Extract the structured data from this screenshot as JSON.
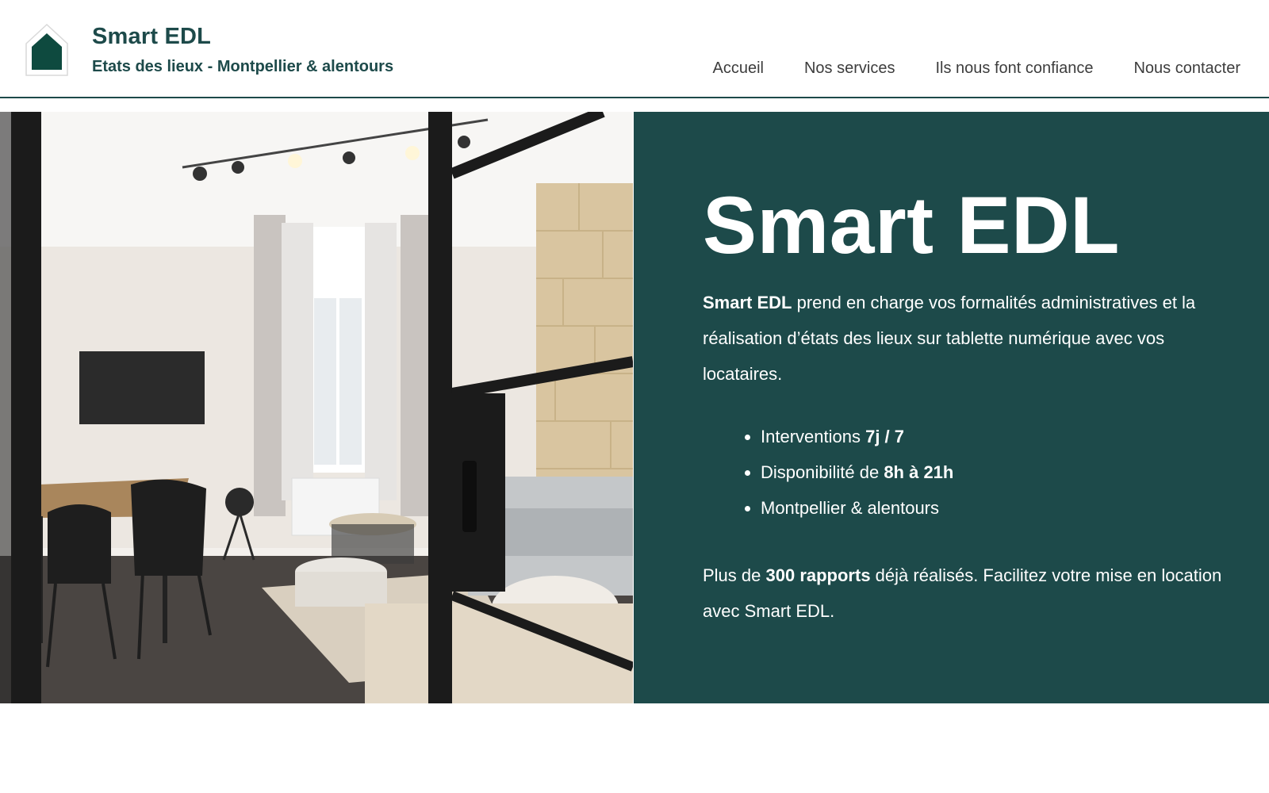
{
  "header": {
    "brand_title": "Smart EDL",
    "brand_subtitle": "Etats des lieux - Montpellier & alentours",
    "logo_icon": "house-icon",
    "nav": [
      {
        "label": "Accueil"
      },
      {
        "label": "Nos services"
      },
      {
        "label": "Ils nous font confiance"
      },
      {
        "label": "Nous contacter"
      }
    ]
  },
  "hero": {
    "image": "apartment-interior-photo",
    "heading": "Smart EDL",
    "intro": {
      "brand": "Smart EDL",
      "text": " prend en charge vos formalités administratives et la réalisation d’états des lieux sur tablette numérique avec vos locataires."
    },
    "bullets": [
      {
        "prefix": "Interventions ",
        "strong": "7j / 7",
        "suffix": ""
      },
      {
        "prefix": "Disponibilité de ",
        "strong": "8h à 21h",
        "suffix": ""
      },
      {
        "prefix": "Montpellier & alentours",
        "strong": "",
        "suffix": ""
      }
    ],
    "outro": {
      "prefix": "Plus de ",
      "strong": "300 rapports",
      "suffix": " déjà réalisés. Facilitez votre mise en location avec Smart EDL."
    }
  },
  "colors": {
    "brand_green": "#1d4a4a",
    "nav_text": "#3d3d3d",
    "white": "#ffffff"
  }
}
